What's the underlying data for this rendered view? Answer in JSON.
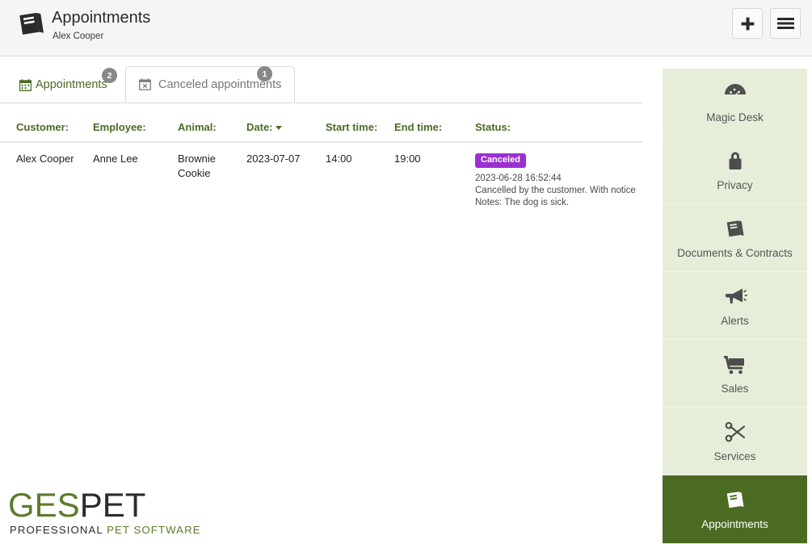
{
  "header": {
    "title": "Appointments",
    "subtitle": "Alex Cooper",
    "icon": "agenda-book-icon",
    "add_button": "add-icon",
    "menu_button": "hamburger-menu-icon"
  },
  "tabs": [
    {
      "label": "Appointments",
      "badge": "2",
      "icon": "calendar-icon",
      "active": false
    },
    {
      "label": "Canceled appointments",
      "badge": "1",
      "icon": "calendar-x-icon",
      "active": true
    }
  ],
  "table": {
    "columns": [
      "Customer:",
      "Employee:",
      "Animal:",
      "Date:",
      "Start time:",
      "End time:",
      "Status:"
    ],
    "sort_column": "Date:",
    "sort_direction": "desc",
    "rows": [
      {
        "customer": "Alex Cooper",
        "employee": "Anne Lee",
        "animal": "Brownie Cookie",
        "date": "2023-07-07",
        "start_time": "14:00",
        "end_time": "19:00",
        "status_badge": "Canceled",
        "status_timestamp": "2023-06-28 16:52:44",
        "status_reason": "Cancelled by the customer. With notice",
        "status_notes": "Notes: The dog is sick."
      }
    ]
  },
  "logo": {
    "part1": "GES",
    "part2": "PET",
    "sub1": "PROFESSIONAL",
    "sub2": "PET SOFTWARE"
  },
  "sidebar": {
    "items": [
      {
        "label": "Magic Desk",
        "icon": "dashboard-gauge-icon",
        "active": false
      },
      {
        "label": "Privacy",
        "icon": "lock-icon",
        "active": false
      },
      {
        "label": "Documents & Contracts",
        "icon": "book-icon",
        "active": false
      },
      {
        "label": "Alerts",
        "icon": "megaphone-icon",
        "active": false
      },
      {
        "label": "Sales",
        "icon": "shopping-cart-icon",
        "active": false
      },
      {
        "label": "Services",
        "icon": "scissors-icon",
        "active": false
      },
      {
        "label": "Appointments",
        "icon": "agenda-book-icon",
        "active": true
      }
    ]
  },
  "colors": {
    "accent_green": "#4a6b24",
    "sidebar_bg": "#e6eed9",
    "active_green": "#4b6b23",
    "status_purple": "#9b30d0",
    "badge_gray": "#888888"
  }
}
